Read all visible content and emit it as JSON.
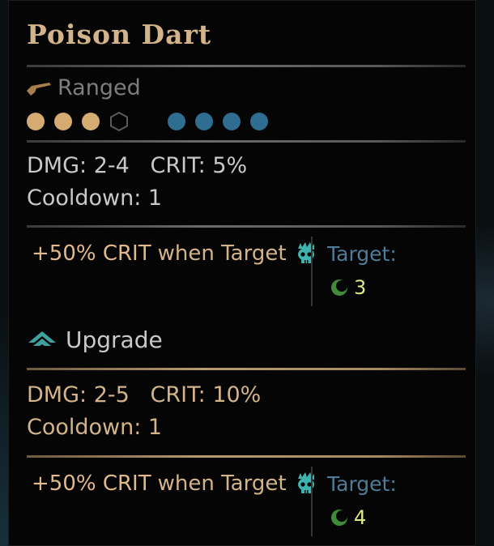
{
  "tooltip": {
    "title": "Poison Dart",
    "type_icon": "pistol-icon",
    "type_label": "Ranged",
    "position_pips": {
      "rank_filled": 3,
      "rank_empty": 1,
      "target_filled": 4,
      "colors": {
        "rank": "#d6ab72",
        "target": "#2f6d91"
      }
    },
    "base": {
      "dmg": "DMG: 2-4",
      "crit": "CRIT: 5%",
      "cooldown": "Cooldown: 1",
      "effect_crit": "+50% CRIT",
      "effect_when": "when Target",
      "effect_icon": "skull-icon",
      "target_label": "Target:",
      "target_icon": "crescent-icon",
      "target_value": "3"
    },
    "upgrade": {
      "label": "Upgrade",
      "icon": "upgrade-chevron-icon",
      "dmg": "DMG: 2-5",
      "crit": "CRIT: 10%",
      "cooldown": "Cooldown: 1",
      "effect_crit": "+50% CRIT",
      "effect_when": "when Target",
      "effect_icon": "skull-icon",
      "target_label": "Target:",
      "target_icon": "crescent-icon",
      "target_value": "4"
    }
  }
}
